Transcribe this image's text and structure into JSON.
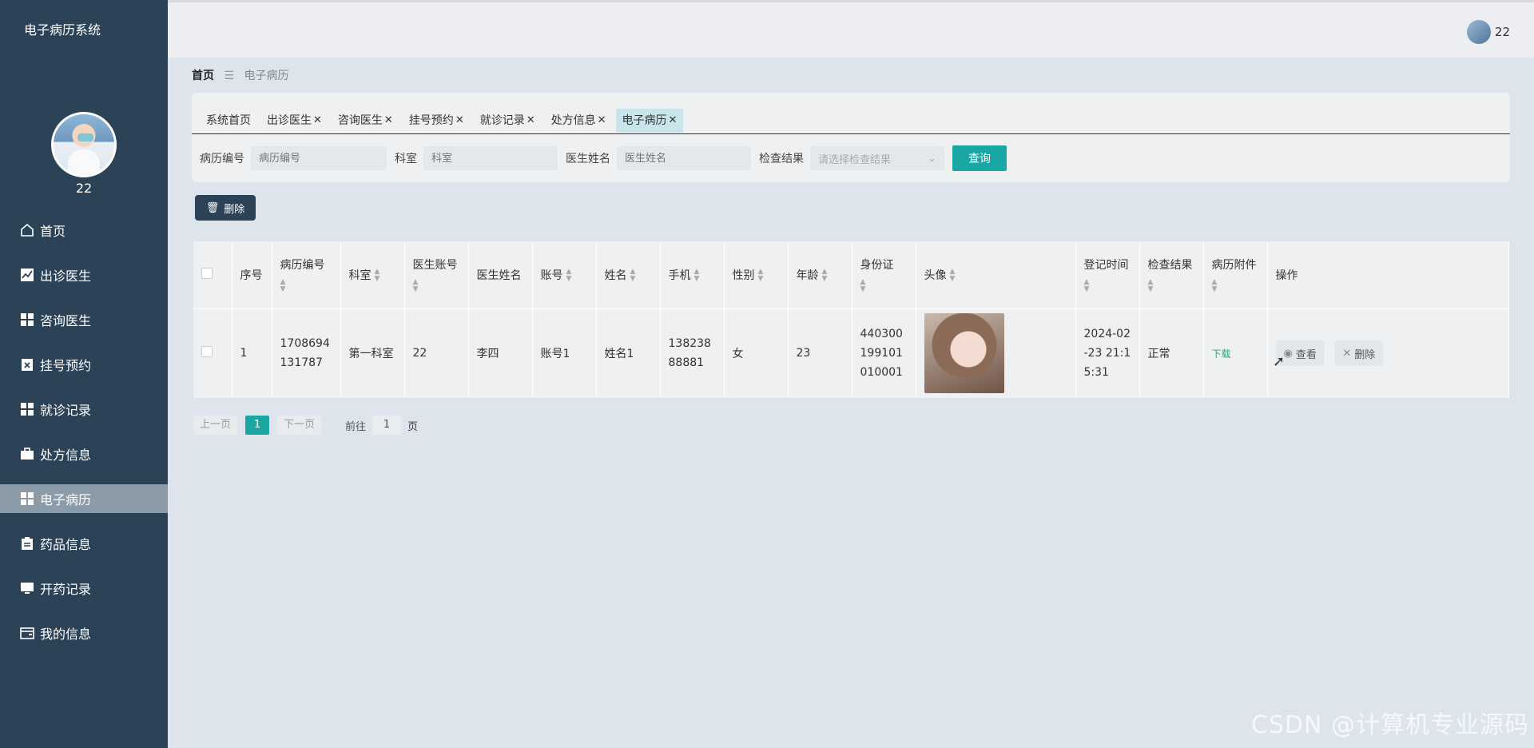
{
  "sidebar": {
    "app_title": "电子病历系统",
    "username": "22",
    "items": [
      {
        "label": "首页",
        "icon": "home-icon"
      },
      {
        "label": "出诊医生",
        "icon": "chart-icon"
      },
      {
        "label": "咨询医生",
        "icon": "grid-icon"
      },
      {
        "label": "挂号预约",
        "icon": "clipboard-x-icon"
      },
      {
        "label": "就诊记录",
        "icon": "grid-icon"
      },
      {
        "label": "处方信息",
        "icon": "briefcase-icon"
      },
      {
        "label": "电子病历",
        "icon": "grid-icon"
      },
      {
        "label": "药品信息",
        "icon": "clipboard-icon"
      },
      {
        "label": "开药记录",
        "icon": "monitor-icon"
      },
      {
        "label": "我的信息",
        "icon": "card-icon"
      }
    ],
    "active_index": 6
  },
  "header": {
    "username": "22"
  },
  "breadcrumb": {
    "home": "首页",
    "current": "电子病历"
  },
  "tabs": [
    {
      "label": "系统首页",
      "closable": false
    },
    {
      "label": "出诊医生",
      "closable": true
    },
    {
      "label": "咨询医生",
      "closable": true
    },
    {
      "label": "挂号预约",
      "closable": true
    },
    {
      "label": "就诊记录",
      "closable": true
    },
    {
      "label": "处方信息",
      "closable": true
    },
    {
      "label": "电子病历",
      "closable": true,
      "active": true
    }
  ],
  "filters": {
    "record_no_label": "病历编号",
    "record_no_placeholder": "病历编号",
    "dept_label": "科室",
    "dept_placeholder": "科室",
    "doctor_label": "医生姓名",
    "doctor_placeholder": "医生姓名",
    "result_label": "检查结果",
    "result_placeholder": "请选择检查结果",
    "query_label": "查询"
  },
  "toolbar": {
    "delete_label": "删除"
  },
  "table": {
    "headers": [
      "序号",
      "病历编号",
      "科室",
      "医生账号",
      "医生姓名",
      "账号",
      "姓名",
      "手机",
      "性别",
      "年龄",
      "身份证",
      "头像",
      "登记时间",
      "检查结果",
      "病历附件",
      "操作"
    ],
    "rows": [
      {
        "index": "1",
        "record_no": "1708694131787",
        "dept": "第一科室",
        "doctor_account": "22",
        "doctor_name": "李四",
        "account": "账号1",
        "name": "姓名1",
        "phone": "13823888881",
        "gender": "女",
        "age": "23",
        "id_card": "440300199101010001",
        "reg_time": "2024-02-23 21:15:31",
        "result": "正常",
        "attachment": "下载",
        "view_label": "查看",
        "delete_label": "删除"
      }
    ]
  },
  "pagination": {
    "prev": "上一页",
    "current": "1",
    "next": "下一页",
    "goto_label": "前往",
    "goto_value": "1",
    "page_suffix": "页"
  },
  "watermark": "CSDN @计算机专业源码",
  "colors": {
    "sidebar": "#2b4257",
    "accent": "#1aa7a4",
    "active_menu": "#8b9ba8"
  }
}
